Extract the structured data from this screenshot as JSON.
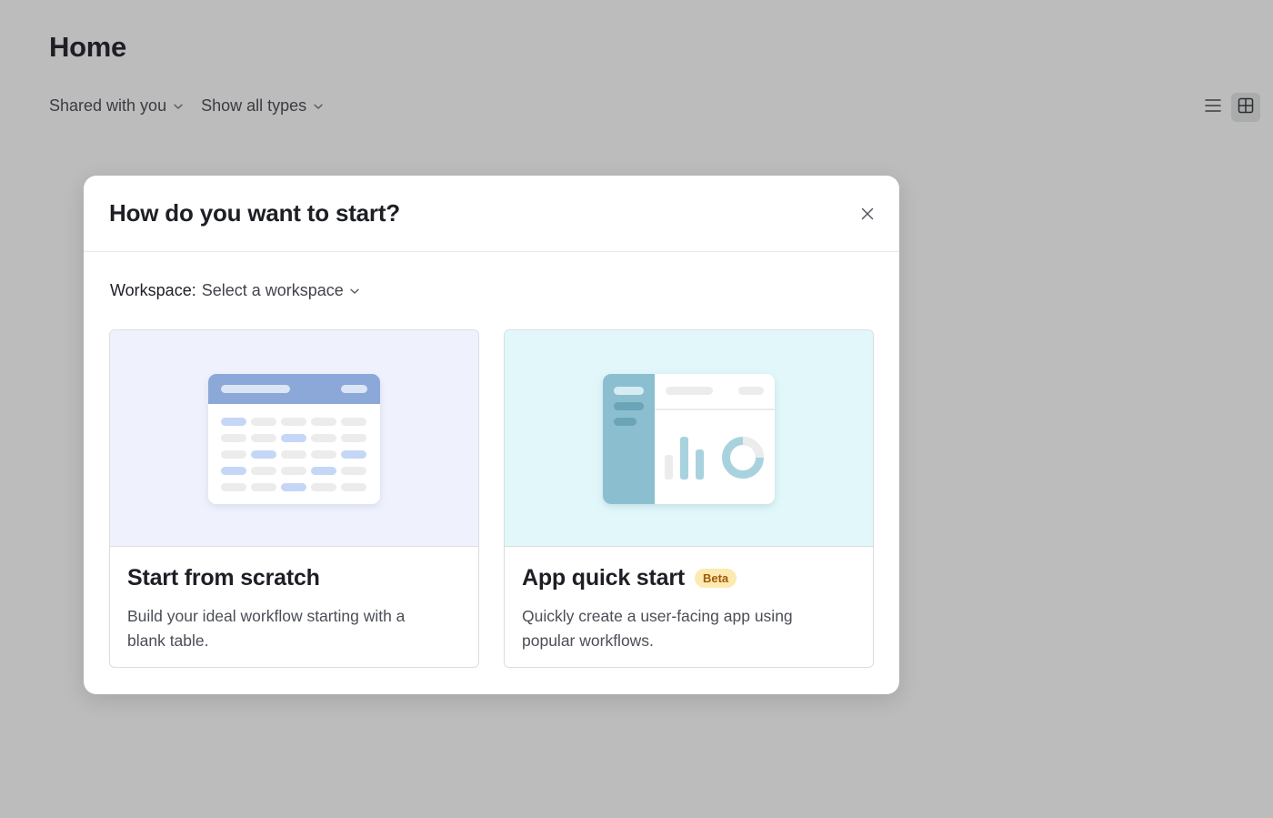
{
  "page": {
    "title": "Home"
  },
  "filters": {
    "shared": {
      "label": "Shared with you"
    },
    "types": {
      "label": "Show all types"
    }
  },
  "view_toggle": {
    "list": {
      "icon": "list-view-icon"
    },
    "grid": {
      "icon": "grid-view-icon",
      "active": true
    }
  },
  "modal": {
    "title": "How do you want to start?",
    "close_icon": "close-icon",
    "workspace": {
      "label": "Workspace:",
      "value": "Select a workspace"
    },
    "cards": [
      {
        "title": "Start from scratch",
        "description": "Build your ideal workflow starting with a blank table.",
        "illustration": "blank-table-illustration"
      },
      {
        "title": "App quick start",
        "badge": "Beta",
        "description": "Quickly create a user-facing app using popular workflows.",
        "illustration": "app-dashboard-illustration"
      }
    ]
  },
  "colors": {
    "backdrop": "#bbbcbb",
    "scratch_bg": "#eff2fd",
    "quick_bg": "#e2f7fa",
    "table_header": "#8ba8d8",
    "app_sidebar": "#8bbfd0",
    "badge_bg": "#fdeab0",
    "badge_text": "#9e5a0a"
  }
}
